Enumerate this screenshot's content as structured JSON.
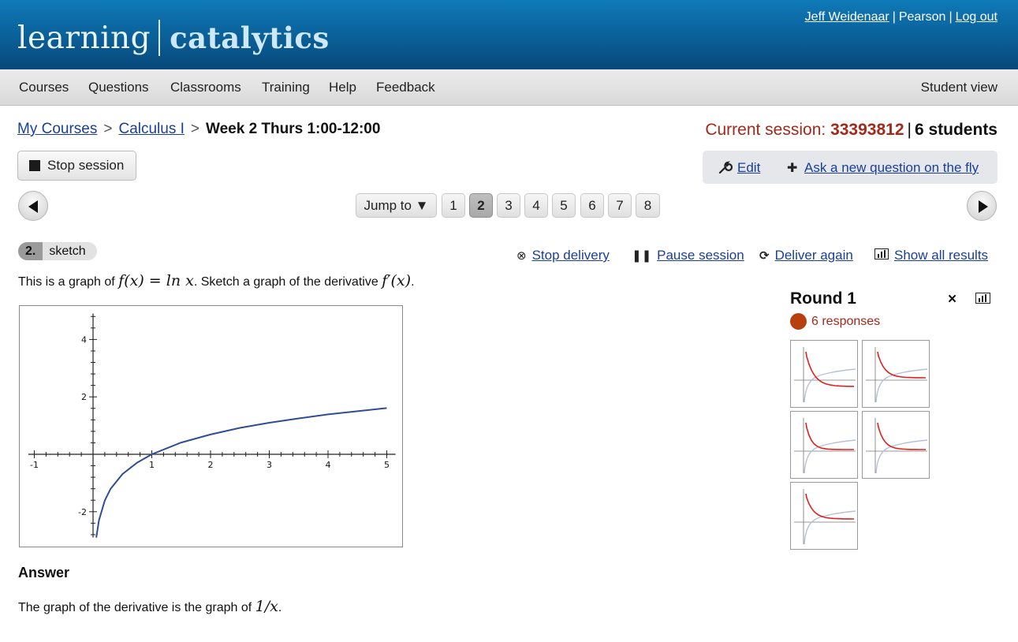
{
  "header": {
    "logo_light": "learning",
    "logo_bold": "catalytics",
    "user_name": "Jeff Weidenaar",
    "org": "Pearson",
    "logout": "Log out",
    "pipe": "|"
  },
  "nav": {
    "items": [
      "Courses",
      "Questions",
      "Classrooms",
      "Training",
      "Help",
      "Feedback"
    ],
    "student_view": "Student view"
  },
  "breadcrumb": {
    "my_courses": "My Courses",
    "course": "Calculus I",
    "current": "Week 2 Thurs 1:00-12:00",
    "sep": ">"
  },
  "session": {
    "label": "Current session:",
    "number": "33393812",
    "bar": "|",
    "students": "6 students"
  },
  "toolbar": {
    "stop_session": "Stop session",
    "edit": "Edit",
    "ask_new": "Ask a new question on the fly"
  },
  "pager": {
    "jump_to": "Jump to ▼",
    "pages": [
      "1",
      "2",
      "3",
      "4",
      "5",
      "6",
      "7",
      "8"
    ],
    "active_page": "2"
  },
  "question": {
    "number": "2.",
    "kind": "sketch",
    "text_before": "This is a graph of ",
    "math_f": "f(x) = ln x",
    "text_middle": ". Sketch a graph of the derivative ",
    "math_fprime": "f′(x)",
    "text_end": "."
  },
  "actions": {
    "stop_delivery": "Stop delivery",
    "pause_session": "Pause session",
    "deliver_again": "Deliver again",
    "show_all_results": "Show all results"
  },
  "chart_data": {
    "type": "line",
    "title": "",
    "xlabel": "",
    "ylabel": "",
    "xlim": [
      -1.1,
      5.15
    ],
    "ylim": [
      -2.9,
      4.9
    ],
    "xticks": [
      "-1",
      "1",
      "2",
      "3",
      "4",
      "5"
    ],
    "yticks": [
      "4",
      "2",
      "-2"
    ],
    "series": [
      {
        "color": "#2f4d96",
        "x": [
          0.055,
          0.1,
          0.2,
          0.3,
          0.5,
          0.75,
          1,
          1.5,
          2,
          2.5,
          3,
          3.5,
          4,
          4.5,
          5
        ],
        "y": [
          -2.9,
          -2.3,
          -1.61,
          -1.2,
          -0.69,
          -0.29,
          0,
          0.41,
          0.69,
          0.92,
          1.1,
          1.25,
          1.39,
          1.5,
          1.61
        ]
      }
    ],
    "grid": false
  },
  "answer": {
    "heading": "Answer",
    "text": "The graph of the derivative is the graph of ",
    "math": "1/x",
    "end": "."
  },
  "results": {
    "round": "Round 1",
    "close_icon": "×",
    "responses": "6 responses",
    "thumbnail_count": 5
  },
  "colors": {
    "header_blue": "#0a5f97",
    "link_blue": "#1a3f9a",
    "session_red": "#a5281a",
    "curve_blue": "#2f4d96",
    "response_red": "#e02020"
  }
}
